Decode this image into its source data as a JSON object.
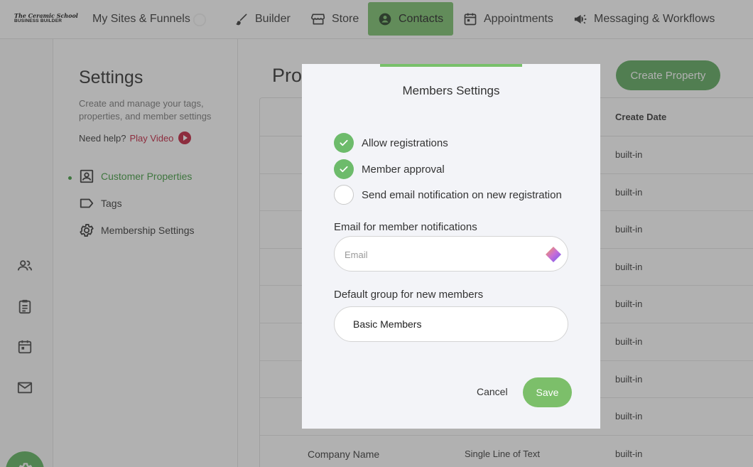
{
  "topnav": {
    "logo_line1": "The Ceramic School",
    "logo_line2": "BUSINESS BUILDER",
    "items": [
      {
        "label": "My Sites & Funnels",
        "icon": "none"
      },
      {
        "label": "Builder",
        "icon": "brush-icon"
      },
      {
        "label": "Store",
        "icon": "store-icon"
      },
      {
        "label": "Contacts",
        "icon": "contacts-icon",
        "active": true
      },
      {
        "label": "Appointments",
        "icon": "calendar-icon"
      },
      {
        "label": "Messaging & Workflows",
        "icon": "megaphone-icon"
      }
    ]
  },
  "rail": {
    "icons": [
      "people-icon",
      "clipboard-icon",
      "calendar-icon",
      "mail-icon",
      "gear-icon"
    ]
  },
  "settings": {
    "title": "Settings",
    "description": "Create and manage your tags, properties, and member settings",
    "help_text": "Need help?",
    "play_video": "Play Video",
    "menu": [
      {
        "label": "Customer Properties",
        "icon": "contact-card-icon",
        "active": true
      },
      {
        "label": "Tags",
        "icon": "tag-icon"
      },
      {
        "label": "Membership Settings",
        "icon": "gear-icon"
      }
    ]
  },
  "main": {
    "title": "Pro",
    "create_button": "Create Property",
    "table": {
      "column_create_date": "Create Date",
      "rows": [
        {
          "name": "",
          "type": "",
          "date": "built-in"
        },
        {
          "name": "",
          "type": "",
          "date": "built-in"
        },
        {
          "name": "",
          "type": "",
          "date": "built-in"
        },
        {
          "name": "",
          "type": "",
          "date": "built-in"
        },
        {
          "name": "",
          "type": "",
          "date": "built-in"
        },
        {
          "name": "",
          "type": "",
          "date": "built-in"
        },
        {
          "name": "",
          "type": "",
          "date": "built-in"
        },
        {
          "name": "",
          "type": "",
          "date": "built-in"
        },
        {
          "name": "Company Name",
          "type": "Single Line of Text",
          "date": "built-in"
        }
      ]
    }
  },
  "modal": {
    "title": "Members Settings",
    "checks": [
      {
        "label": "Allow registrations",
        "checked": true
      },
      {
        "label": "Member approval",
        "checked": true
      },
      {
        "label": "Send email notification on new registration",
        "checked": false
      }
    ],
    "email_label": "Email for member notifications",
    "email_placeholder": "Email",
    "email_value": "",
    "group_label": "Default group for new members",
    "group_value": "Basic Members",
    "cancel_label": "Cancel",
    "save_label": "Save",
    "accent_color": "#78c06a"
  }
}
